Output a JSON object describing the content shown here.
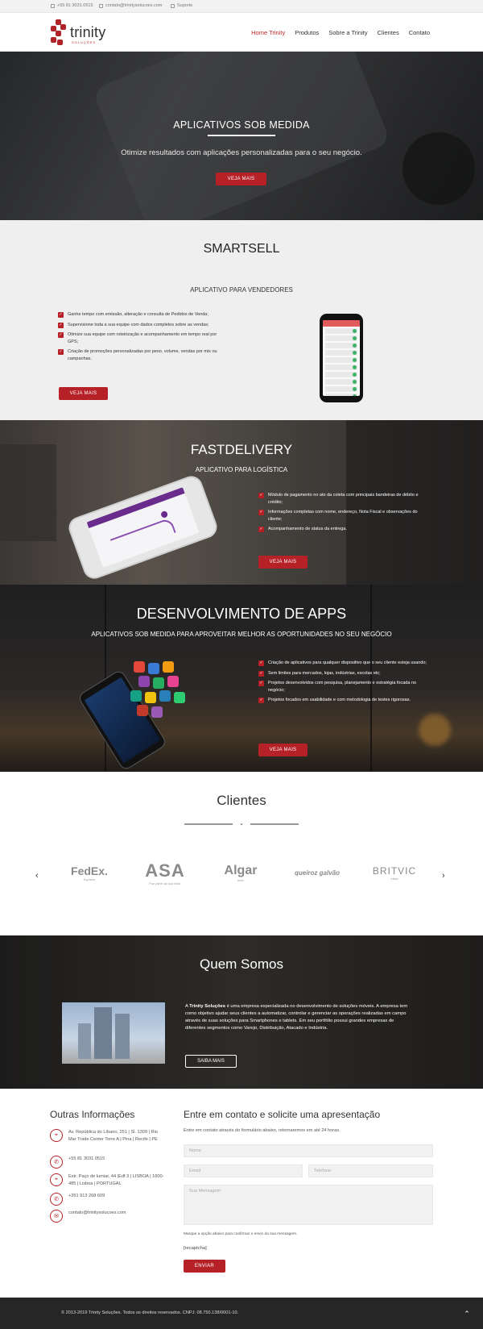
{
  "topbar": {
    "phone": "+55 81 3031.0515",
    "email": "contato@trinitysolucoes.com",
    "support": "Suporte"
  },
  "brand": {
    "name": "trinity",
    "sub": "SOLUÇÕES"
  },
  "nav": [
    {
      "label": "Home Trinity",
      "active": true
    },
    {
      "label": "Produtos"
    },
    {
      "label": "Sobre a Trinity"
    },
    {
      "label": "Clientes"
    },
    {
      "label": "Contato"
    }
  ],
  "hero": {
    "title": "APLICATIVOS SOB MEDIDA",
    "subtitle": "Otimize resultados com aplicações personalizadas para o seu negócio.",
    "button": "VEJA MAIS"
  },
  "smartsell": {
    "title": "SMARTSELL",
    "subtitle": "APLICATIVO PARA VENDEDORES",
    "items": [
      "Ganhe tempo com emissão, alteração e consulta de Pedidos de Venda;",
      "Supervisione toda a sua equipe com dados completos sobre as vendas;",
      "Otimize sua equipe com roteirização e acompanhamento em tempo real por GPS;",
      "Criação de promoções personalizadas por peso, volume, vendas por mix ou campanhas."
    ],
    "button": "VEJA MAIS"
  },
  "fastdelivery": {
    "title": "FASTDELIVERY",
    "subtitle": "APLICATIVO PARA LOGÍSTICA",
    "items": [
      "Módulo de pagamento no ato da coleta com principais bandeiras de débito e crédito;",
      "Informações completas com nome, endereço, Nota Fiscal e observações do cliente;",
      "Acompanhamento de status da entrega."
    ],
    "button": "VEJA MAIS"
  },
  "dev": {
    "title": "DESENVOLVIMENTO DE APPS",
    "subtitle": "APLICATIVOS SOB MEDIDA PARA APROVEITAR MELHOR AS OPORTUNIDADES NO SEU NEGÓCIO",
    "items": [
      "Criação de aplicativos para qualquer dispositivo que o seu cliente esteja usando;",
      "Sem limites para mercados, lojas, indústrias, escolas etc;",
      "Projetos desenvolvidos com pesquisa, planejamento e estratégia focada no negócio;",
      "Projetos focados em usabilidade e com metodologia de testes rigorosas."
    ],
    "button": "VEJA MAIS"
  },
  "clientes": {
    "title": "Clientes",
    "logos": [
      {
        "name": "FedEx.",
        "sub": "Express"
      },
      {
        "name": "ASA",
        "sub": "Faz parte da sua vida."
      },
      {
        "name": "Algar",
        "sub": "tech"
      },
      {
        "name": "queiroz galvão",
        "sub": ""
      },
      {
        "name": "BRITVIC",
        "sub": "ebba"
      }
    ]
  },
  "quem": {
    "title": "Quem Somos",
    "text_prefix": "A ",
    "text_bold": "Trinity Soluções",
    "text_rest": " é uma empresa especializada no desenvolvimento de soluções móveis. A empresa tem como objetivo ajudar seus clientes a automatizar, controlar e gerenciar as operações realizadas em campo através de suas soluções para Smartphones e tablets. Em seu portfólio possui grandes empresas de diferentes segmentos como Varejo, Distribuição, Atacado e Indústria.",
    "button": "SAIBA MAIS"
  },
  "info": {
    "title": "Outras Informações",
    "items": [
      {
        "icon": "map-pin-icon",
        "text": "Av. República do Líbano, 251 | Sl. 1309 | Rio Mar Trade Center Torre A | Pina | Recife | PE"
      },
      {
        "icon": "phone-icon",
        "text": "+55 81 3031.0515"
      },
      {
        "icon": "map-pin-icon",
        "text": "Estr. Paço de lumiar, 44 |Edf 3 | LISBOA | 1600-485 | Lisboa | PORTUGAL"
      },
      {
        "icon": "phone-icon",
        "text": "+351 913 268 609"
      },
      {
        "icon": "mail-icon",
        "text": "contato@trinitysolucoes.com"
      }
    ]
  },
  "form": {
    "title": "Entre em contato e solicite uma apresentação",
    "desc": "Entre em contato através do formulário abaixo, retornaremos em até 24 horas.",
    "name_ph": "Nome",
    "email_ph": "Email",
    "phone_ph": "Telefone",
    "message_ph": "Sua Mensagem",
    "note": "Marque a opção abaixo para confirmar o envio da sua mensagem.",
    "recaptcha": "[recaptcha]",
    "submit": "ENVIAR"
  },
  "footer": {
    "copyright": "© 2013-2019 Trinity Soluções. Todos os direitos reservados. CNPJ: 08.750.138/0001-10."
  }
}
